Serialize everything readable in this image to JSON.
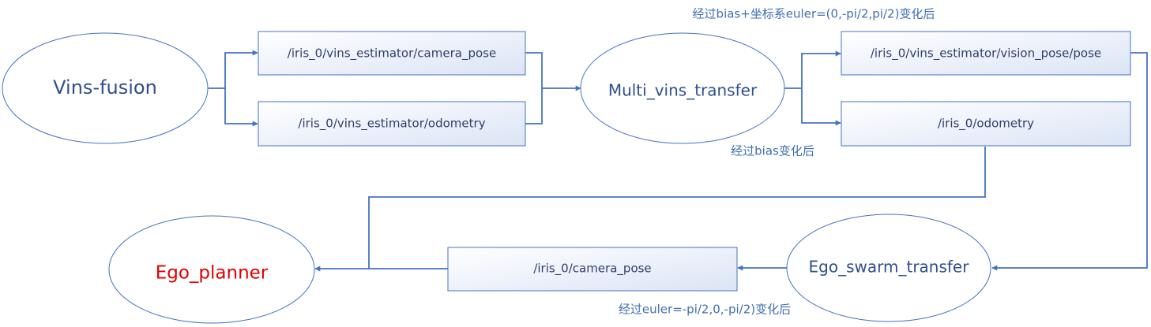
{
  "nodes": {
    "vins_fusion": "Vins-fusion",
    "multi_vins_transfer": "Multi_vins_transfer",
    "ego_swarm_transfer": "Ego_swarm_transfer",
    "ego_planner": "Ego_planner"
  },
  "topics": {
    "camera_pose_in": "/iris_0/vins_estimator/camera_pose",
    "odometry_in": "/iris_0/vins_estimator/odometry",
    "vision_pose": "/iris_0/vins_estimator/vision_pose/pose",
    "odometry_out": "/iris_0/odometry",
    "camera_pose_out": "/iris_0/camera_pose"
  },
  "notes": {
    "bias_euler": "经过bias+坐标系euler=(0,-pi/2,pi/2)变化后",
    "bias_only": "经过bias变化后",
    "euler_only": "经过euler=-pi/2,0,-pi/2)变化后"
  },
  "colors": {
    "stroke": "#4472c4",
    "node_text": "#2f4f8f",
    "highlight_text": "#e00000",
    "box_fill_start": "#ffffff",
    "box_fill_end": "#dbe4f5",
    "note_text": "#3f6fb3"
  },
  "icons": {
    "arrowhead": "arrow-head-icon"
  }
}
